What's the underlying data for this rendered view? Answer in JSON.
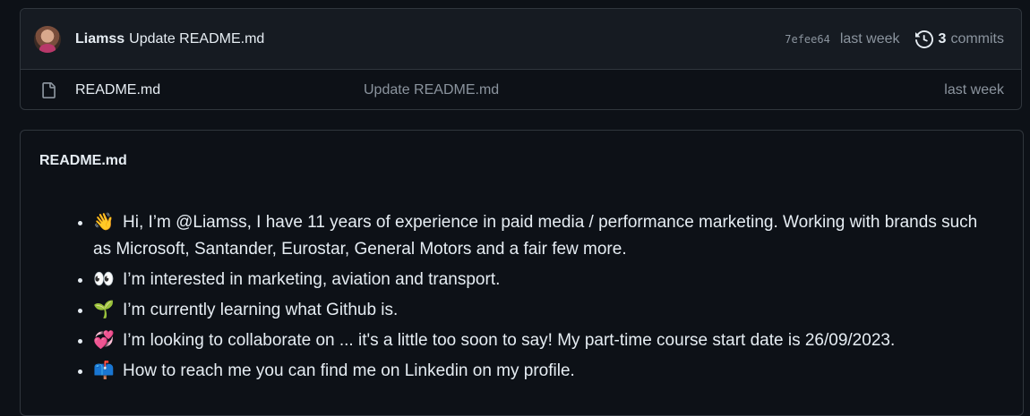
{
  "commit_bar": {
    "author": "Liamss",
    "message": "Update README.md",
    "sha": "7efee64",
    "time": "last week",
    "commit_count": "3",
    "commits_label": "commits"
  },
  "files": [
    {
      "name": "README.md",
      "last_commit_message": "Update README.md",
      "last_commit_time": "last week",
      "icon": "file-icon"
    }
  ],
  "readme": {
    "title": "README.md",
    "items": [
      {
        "emoji": "👋",
        "text": "Hi, I’m @Liamss, I have 11 years of experience in paid media / performance marketing. Working with brands such as Microsoft, Santander, Eurostar, General Motors and a fair few more."
      },
      {
        "emoji": "👀",
        "text": "I’m interested in marketing, aviation and transport."
      },
      {
        "emoji": "🌱",
        "text": "I’m currently learning what Github is."
      },
      {
        "emoji": "💞️",
        "text": "I’m looking to collaborate on ... it's a little too soon to say! My part-time course start date is 26/09/2023."
      },
      {
        "emoji": "📫",
        "text": "How to reach me you can find me on Linkedin on my profile."
      }
    ]
  }
}
